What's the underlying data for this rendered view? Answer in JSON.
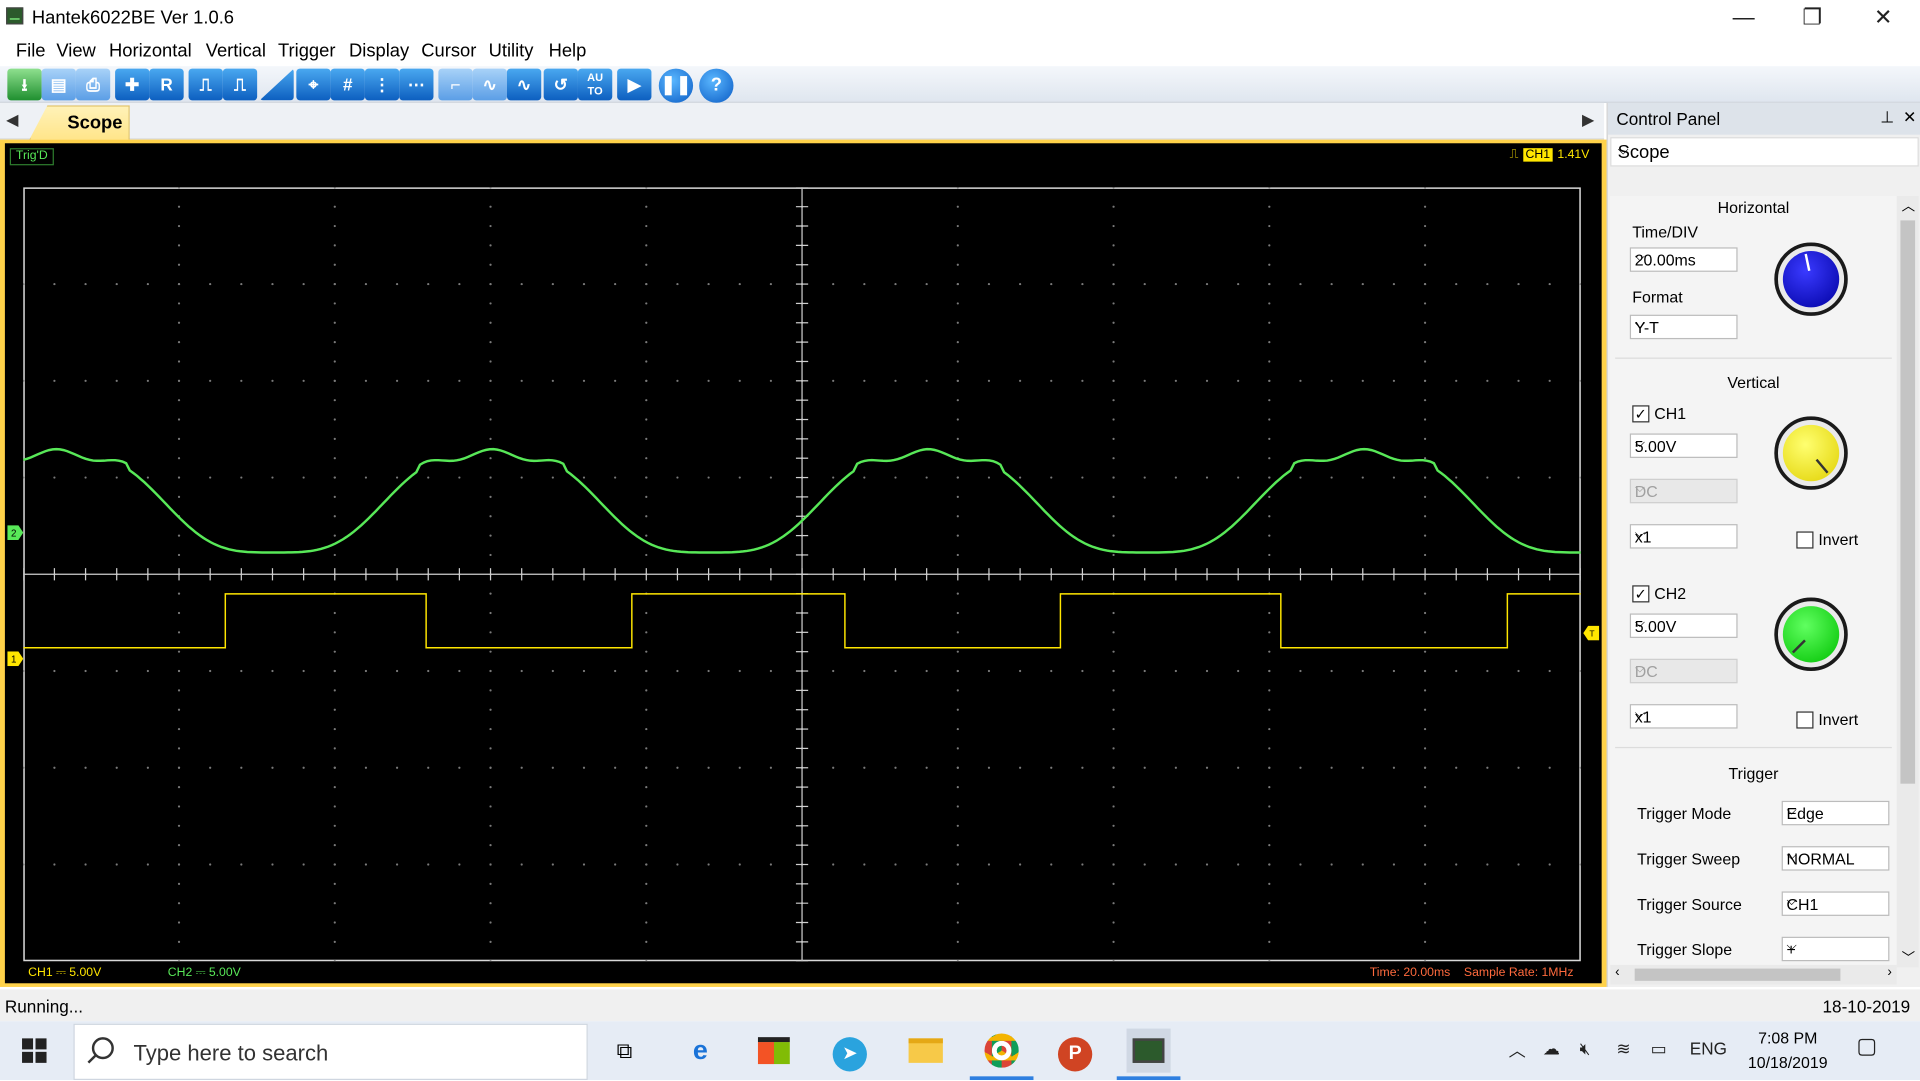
{
  "window": {
    "title": "Hantek6022BE Ver 1.0.6",
    "minimize": "—",
    "restore": "❐",
    "close": "✕"
  },
  "menu": [
    "File",
    "View",
    "Horizontal",
    "Vertical",
    "Trigger",
    "Display",
    "Cursor",
    "Utility",
    "Help"
  ],
  "toolbar": {
    "buttons": [
      "save-data",
      "print",
      "auto-scale",
      "R",
      "measure-1",
      "measure-2",
      "ramp",
      "cursor-cross",
      "cursor-grid",
      "cursor-vertical",
      "cursor-horizontal",
      "step",
      "sine-a",
      "sine-b",
      "undo",
      "AUTO",
      "run",
      "pause",
      "help"
    ],
    "r_label": "R",
    "auto_label": "AU\nTO",
    "help_label": "?"
  },
  "tabs": {
    "active": "Scope",
    "left_arrow": "◀",
    "right_arrow": "▶"
  },
  "scope": {
    "trig_status": "Trig'D",
    "trigger_channel": "CH1",
    "trigger_level": "1.41V",
    "ch1_scale_label": "CH1 ⎓  5.00V",
    "ch2_scale_label": "CH2 ⎓  5.00V",
    "time_label": "Time: 20.00ms",
    "sample_rate_label": "Sample Rate: 1MHz",
    "colors": {
      "ch1": "#ffe600",
      "ch2": "#58e858",
      "grid": "#7a7a7a",
      "frame": "#ffd24a"
    }
  },
  "control_panel": {
    "title": "Control Panel",
    "pin": "📌",
    "close": "✕",
    "mode": "Scope",
    "horizontal": {
      "title": "Horizontal",
      "time_div_label": "Time/DIV",
      "time_div": "20.00ms",
      "format_label": "Format",
      "format": "Y-T",
      "knob_color": "#1010c8"
    },
    "vertical": {
      "title": "Vertical",
      "ch1": {
        "label": "CH1",
        "checked": "✓",
        "volts": "5.00V",
        "coupling": "DC",
        "probe": "x1",
        "invert_label": "Invert",
        "knob_color": "#ffee00"
      },
      "ch2": {
        "label": "CH2",
        "checked": "✓",
        "volts": "5.00V",
        "coupling": "DC",
        "probe": "x1",
        "invert_label": "Invert",
        "knob_color": "#1ee01e"
      }
    },
    "trigger": {
      "title": "Trigger",
      "mode_label": "Trigger Mode",
      "mode": "Edge",
      "sweep_label": "Trigger Sweep",
      "sweep": "NORMAL",
      "source_label": "Trigger Source",
      "source": "CH1",
      "slope_label": "Trigger Slope",
      "slope": "+"
    }
  },
  "statusbar": {
    "left": "Running...",
    "right": "18-10-2019"
  },
  "taskbar": {
    "search_placeholder": "Type here to search",
    "apps": [
      "task-view",
      "edge",
      "store",
      "telegram",
      "file-explorer",
      "chrome",
      "powerpoint",
      "hantek"
    ],
    "tray": {
      "lang": "ENG",
      "time": "7:08 PM",
      "date": "10/18/2019"
    }
  }
}
